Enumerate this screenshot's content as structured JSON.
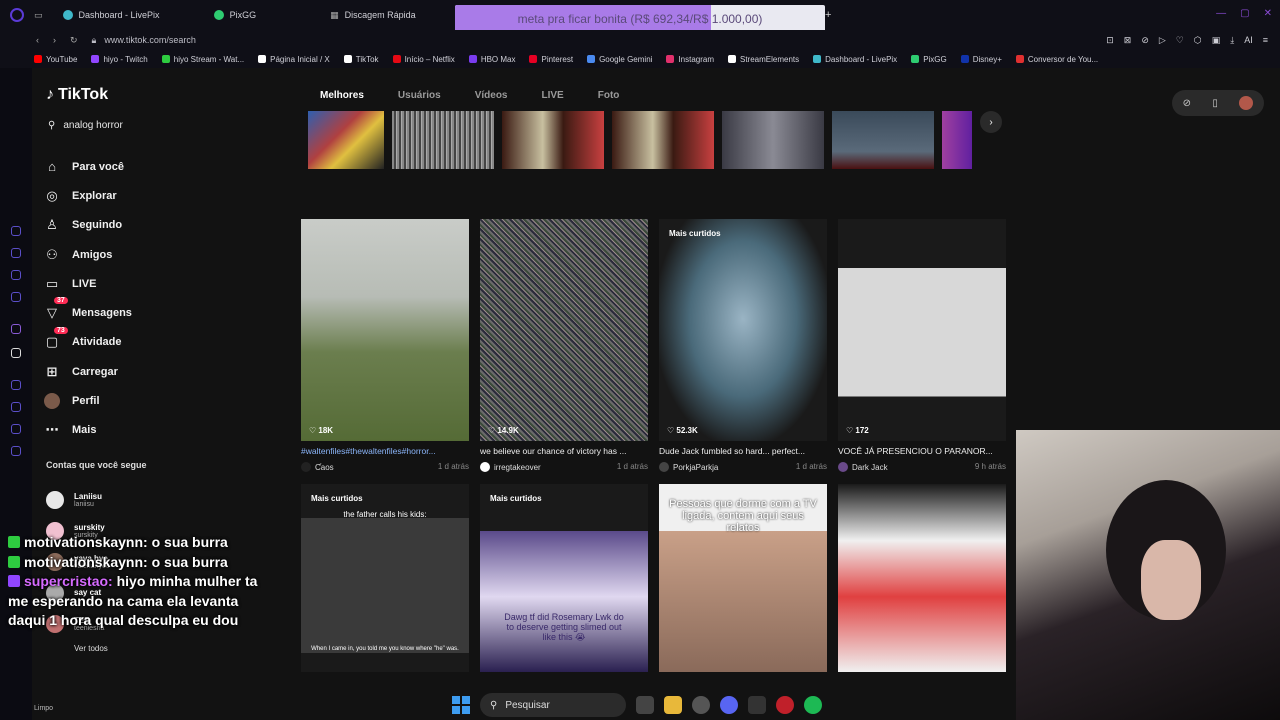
{
  "browser": {
    "tabs": [
      "Dashboard - LivePix",
      "PixGG",
      "Discagem Rápida"
    ],
    "goal_text": "meta pra ficar bonita (R$ 692,34/R$ 1.000,00)",
    "goal_progress": 0.69234,
    "url": "www.tiktok.com/search",
    "ai_label": "AI",
    "bookmarks": [
      "YouTube",
      "hiyo - Twitch",
      "hiyo Stream - Wat...",
      "Página Inicial / X",
      "TikTok",
      "Início – Netflix",
      "HBO Max",
      "Pinterest",
      "Google Gemini",
      "Instagram",
      "StreamElements",
      "Dashboard - LivePix",
      "PixGG",
      "Disney+",
      "Conversor de You..."
    ]
  },
  "tiktok": {
    "logo": "TikTok",
    "search_query": "analog horror",
    "menu": [
      {
        "label": "Para você",
        "icon": "home-icon",
        "glyph": "⌂"
      },
      {
        "label": "Explorar",
        "icon": "compass-icon",
        "glyph": "◎"
      },
      {
        "label": "Seguindo",
        "icon": "following-icon",
        "glyph": "♙"
      },
      {
        "label": "Amigos",
        "icon": "friends-icon",
        "glyph": "⚇"
      },
      {
        "label": "LIVE",
        "icon": "live-icon",
        "glyph": "▭"
      },
      {
        "label": "Mensagens",
        "icon": "messages-icon",
        "glyph": "▽",
        "badge": "37"
      },
      {
        "label": "Atividade",
        "icon": "activity-icon",
        "glyph": "▢",
        "badge": "73"
      },
      {
        "label": "Carregar",
        "icon": "upload-icon",
        "glyph": "⊞"
      },
      {
        "label": "Perfil",
        "icon": "profile-avatar",
        "glyph": ""
      },
      {
        "label": "Mais",
        "icon": "more-icon",
        "glyph": "⋯"
      }
    ],
    "follow_title": "Contas que você segue",
    "following": [
      {
        "name": "Laniisu",
        "handle": "laniisu"
      },
      {
        "name": "surskity",
        "handle": "surskity"
      },
      {
        "name": "vava hye",
        "handle": "valerlahyee"
      },
      {
        "name": "say cat",
        "handle": ""
      },
      {
        "name": "TEE",
        "handle": "teeniesha"
      }
    ],
    "ver_todos": "Ver todos",
    "search_tabs": [
      "Melhores",
      "Usuários",
      "Vídeos",
      "LIVE",
      "Foto"
    ],
    "videos": [
      {
        "tag": "",
        "likes": "18K",
        "desc": "#waltenfiles#thewaltenfiles#horror...",
        "author": "Ƈaos",
        "time": "1 d atrás",
        "caption": ""
      },
      {
        "tag": "",
        "likes": "14.9K",
        "desc": "we believe our chance of victory has ...",
        "author": "irregtakeover",
        "time": "1 d atrás",
        "caption": ""
      },
      {
        "tag": "Mais curtidos",
        "likes": "52.3K",
        "desc": "Dude Jack fumbled so hard... perfect...",
        "author": "PorkjaParkja",
        "time": "1 d atrás",
        "caption": ""
      },
      {
        "tag": "",
        "likes": "172",
        "desc": "VOCÊ JÁ PRESENCIOU O PARANOR...",
        "author": "Dark Jack",
        "time": "9 h atrás",
        "caption": ""
      },
      {
        "tag": "Mais curtidos",
        "likes": "",
        "desc": "",
        "author": "",
        "time": "",
        "caption": "the father calls his kids:",
        "caption2": "When I came in, you told me you know where \"he\" was."
      },
      {
        "tag": "Mais curtidos",
        "likes": "",
        "desc": "",
        "author": "",
        "time": "",
        "caption": "Dawg tf did Rosemary Lwk do to deserve getting slimed out like this 😭"
      },
      {
        "tag": "",
        "likes": "",
        "desc": "",
        "author": "",
        "time": "",
        "caption": "Pessoas que dorme com a TV ligada, contem aqui seus relatos"
      },
      {
        "tag": "",
        "likes": "",
        "desc": "",
        "author": "",
        "time": "",
        "caption": ""
      }
    ]
  },
  "chat": [
    {
      "user": "motivationskaynn:",
      "msg": "o sua burra"
    },
    {
      "user": "motivationskaynn:",
      "msg": "o sua burra"
    },
    {
      "user": "supercristao:",
      "msg": "hiyo minha mulher ta me esperando na cama ela levanta daqui 1 hora qual desculpa eu dou"
    }
  ],
  "taskbar": {
    "search_placeholder": "Pesquisar",
    "limpo": "Limpo"
  }
}
